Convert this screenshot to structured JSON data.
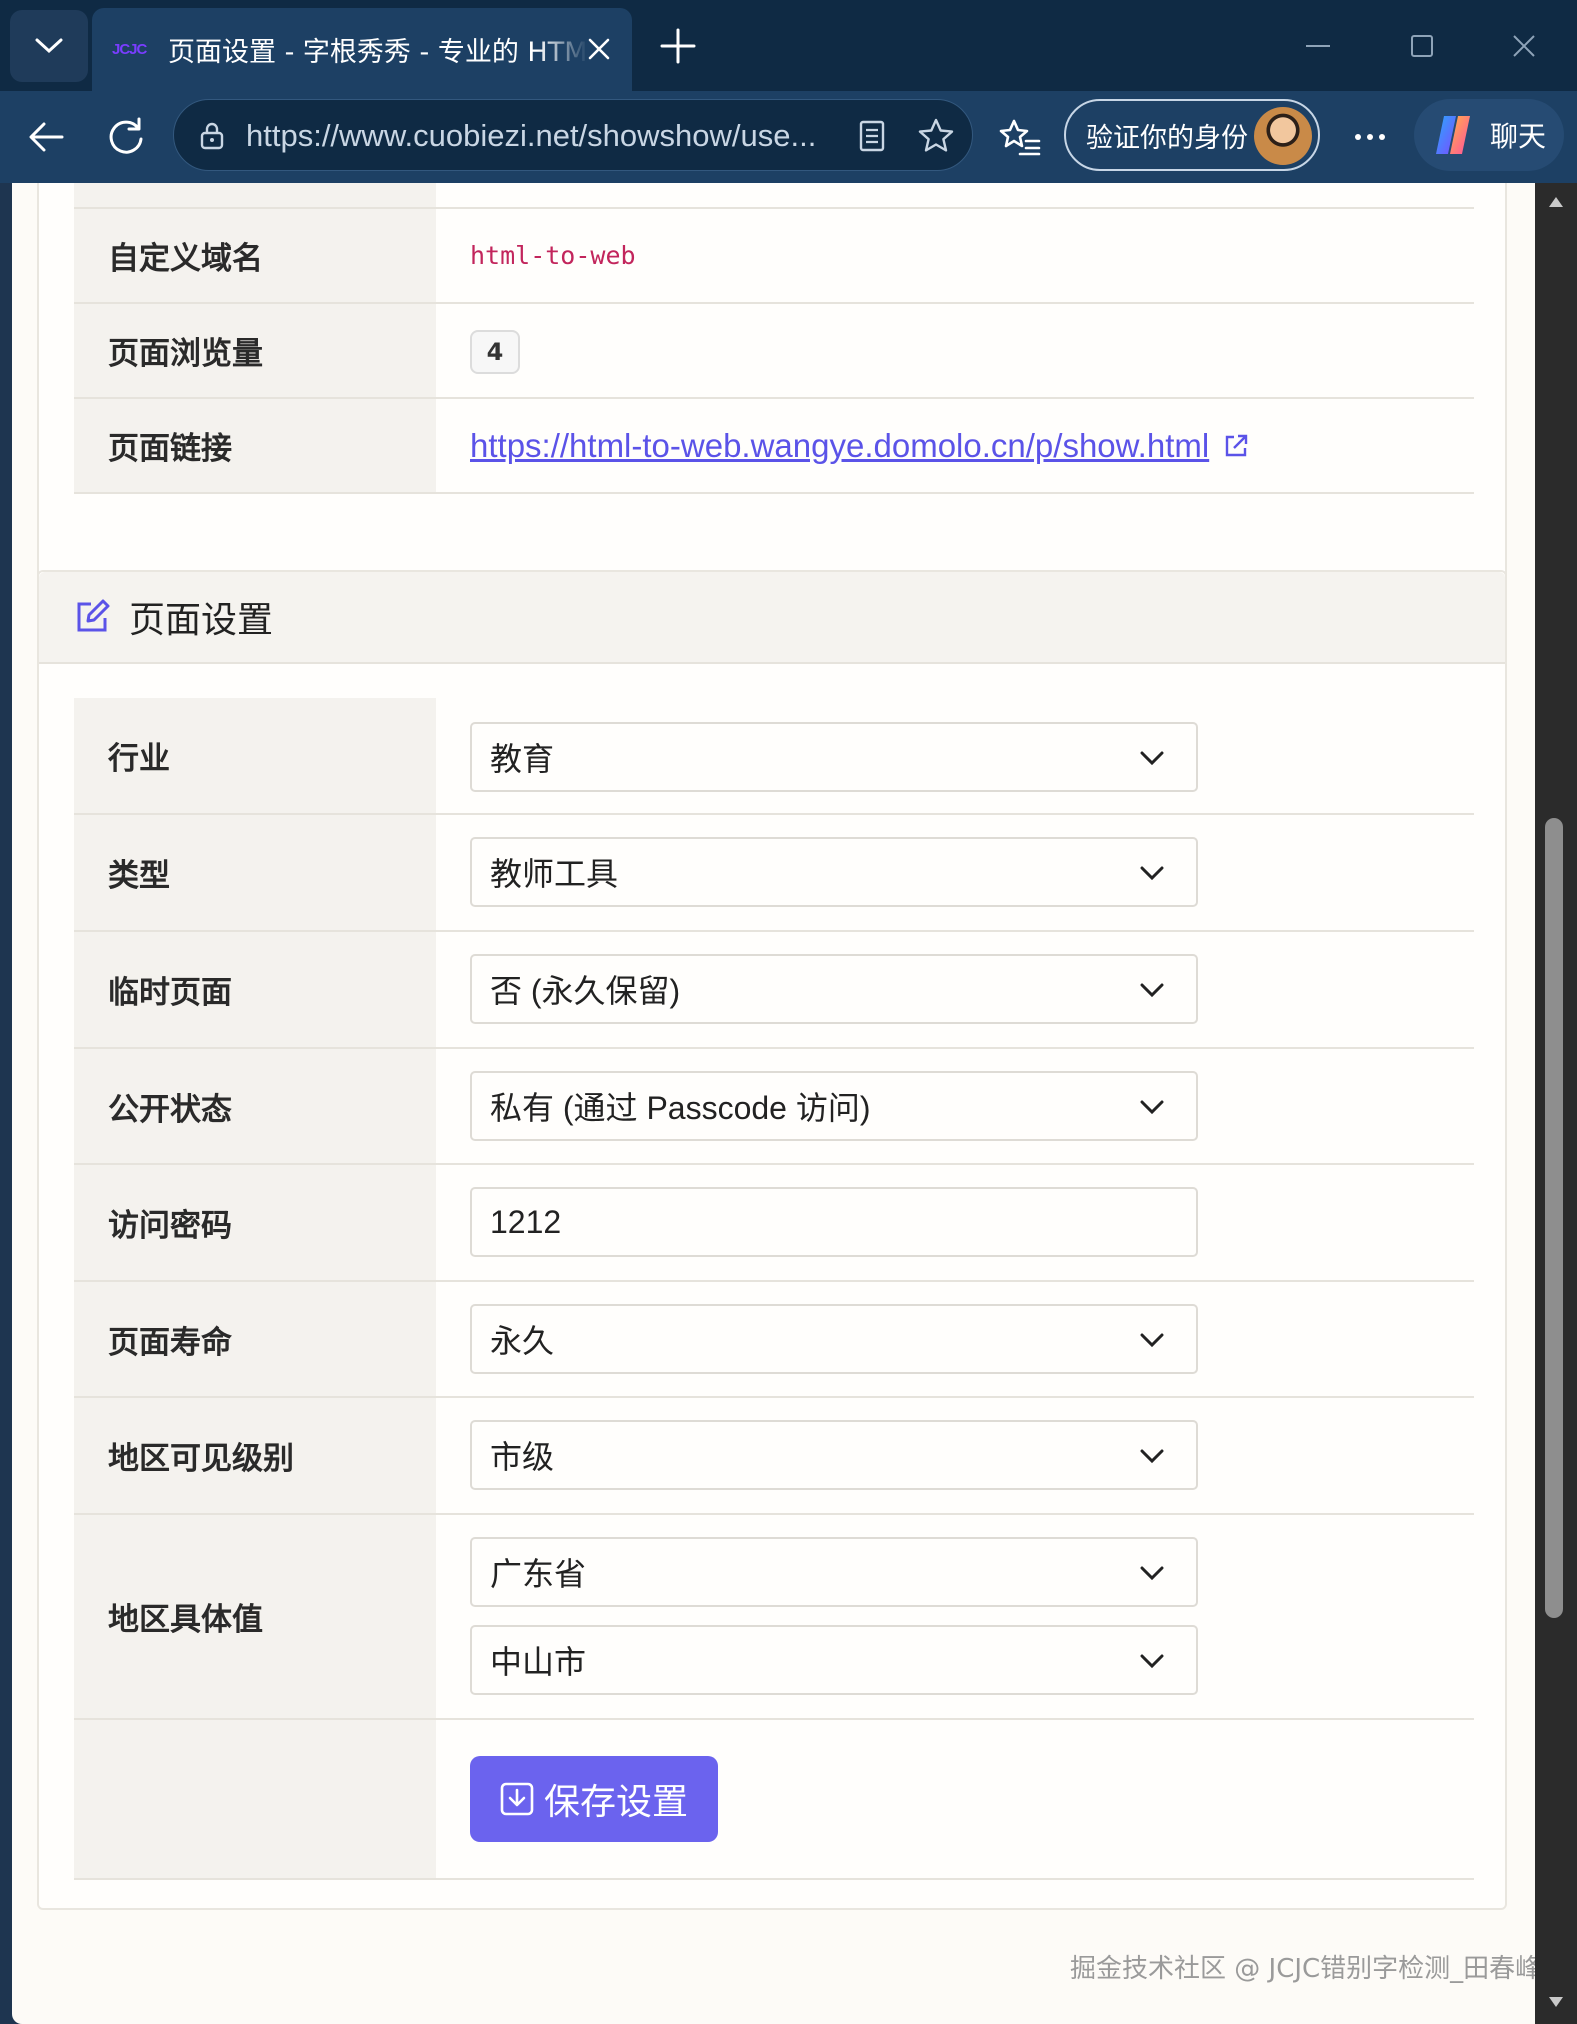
{
  "browser": {
    "tab_title": "页面设置 - 字根秀秀 - 专业的 HTML",
    "tab_favicon_text": "JCJC",
    "url": "https://www.cuobiezi.net/showshow/use...",
    "verify_label": "验证你的身份",
    "chat_label": "聊天"
  },
  "info_card": {
    "rows": [
      {
        "label": "自定义域名",
        "value": "html-to-web"
      },
      {
        "label": "页面浏览量",
        "value": "4"
      },
      {
        "label": "页面链接",
        "value": "https://html-to-web.wangye.domolo.cn/p/show.html "
      }
    ]
  },
  "settings_card": {
    "title": "页面设置",
    "rows": [
      {
        "label": "行业",
        "value": "教育"
      },
      {
        "label": "类型",
        "value": "教师工具"
      },
      {
        "label": "临时页面",
        "value": "否 (永久保留)"
      },
      {
        "label": "公开状态",
        "value": "私有 (通过 Passcode 访问)"
      },
      {
        "label": "访问密码",
        "value": "1212"
      },
      {
        "label": "页面寿命",
        "value": "永久"
      },
      {
        "label": "地区可见级别",
        "value": "市级"
      },
      {
        "label": "地区具体值",
        "province": "广东省",
        "city": "中山市"
      }
    ],
    "save_label": "保存设置"
  },
  "watermark": "掘金技术社区 @ JCJC错别字检测_田春峰",
  "colors": {
    "accent": "#6b63ee",
    "link": "#5b53e8",
    "code": "#c2255c",
    "chrome_dark": "#0f2a44",
    "chrome": "#1d4064"
  }
}
